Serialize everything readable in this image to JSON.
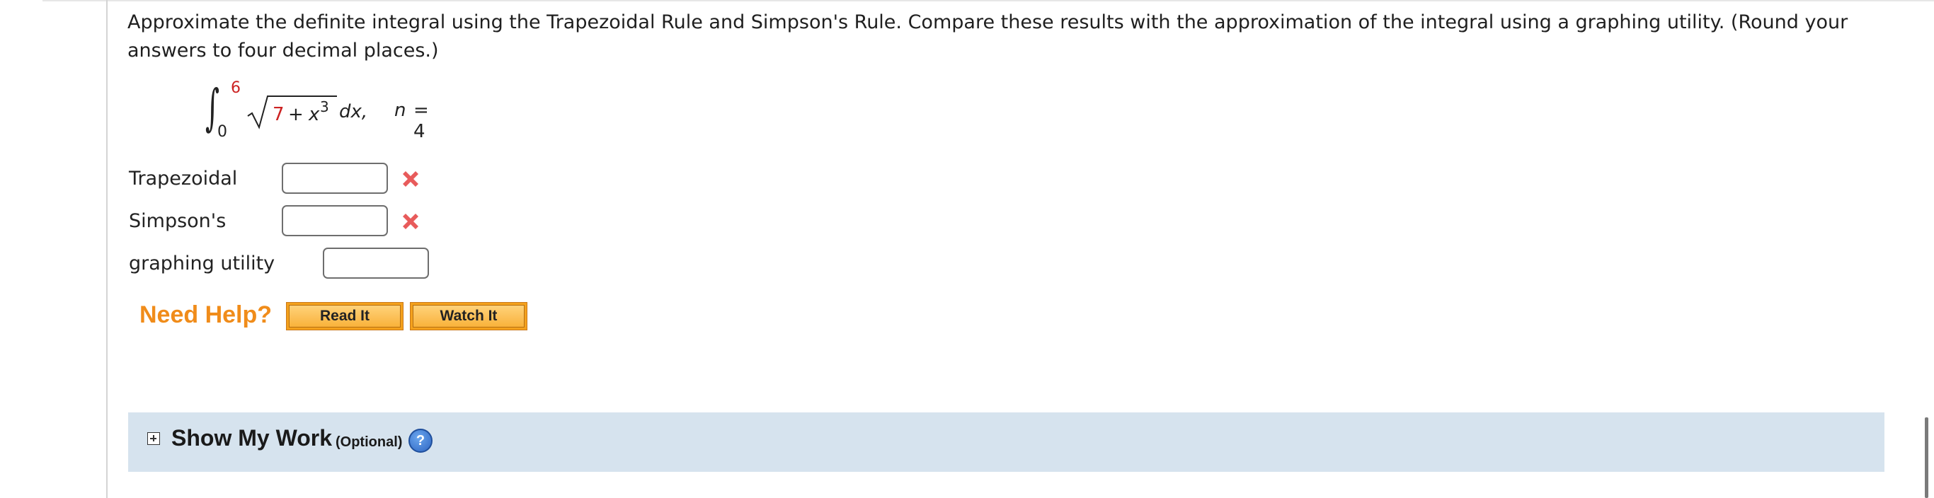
{
  "question": {
    "text": "Approximate the definite integral using the Trapezoidal Rule and Simpson's Rule. Compare these results with the approximation of the integral using a graphing utility. (Round your answers to four decimal places.)"
  },
  "integral": {
    "upper_limit": "6",
    "lower_limit": "0",
    "radicand_number": "7",
    "radicand_plus": "+",
    "radicand_variable": "x",
    "radicand_exponent": "3",
    "differential": "dx,",
    "n_variable": "n",
    "n_value": "= 4",
    "colors": {
      "given_value": "#cc2222"
    }
  },
  "answers": [
    {
      "label": "Trapezoidal",
      "value": "",
      "status": "incorrect",
      "status_icon": "x-mark-icon"
    },
    {
      "label": "Simpson's",
      "value": "",
      "status": "incorrect",
      "status_icon": "x-mark-icon"
    },
    {
      "label": "graphing utility",
      "value": ""
    }
  ],
  "help": {
    "title": "Need Help?",
    "read_it": "Read It",
    "watch_it": "Watch It",
    "colors": {
      "title": "#f08c1a",
      "button": "#f4a11c"
    }
  },
  "show_my_work": {
    "title": "Show My Work",
    "optional": "(Optional)",
    "help_glyph": "?",
    "colors": {
      "background": "#d6e3ee"
    }
  }
}
